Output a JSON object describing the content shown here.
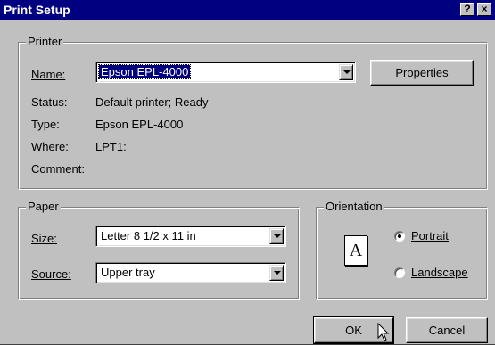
{
  "window": {
    "title": "Print Setup",
    "help_button": "?",
    "close_button": "×"
  },
  "printer_group": {
    "label": "Printer",
    "name_label": "Name:",
    "name_value": "Epson EPL-4000",
    "properties_button": "Properties",
    "status_label": "Status:",
    "status_value": "Default printer; Ready",
    "type_label": "Type:",
    "type_value": "Epson EPL-4000",
    "where_label": "Where:",
    "where_value": "LPT1:",
    "comment_label": "Comment:",
    "comment_value": ""
  },
  "paper_group": {
    "label": "Paper",
    "size_label": "Size:",
    "size_value": "Letter 8 1/2 x 11 in",
    "source_label": "Source:",
    "source_value": "Upper tray"
  },
  "orientation_group": {
    "label": "Orientation",
    "icon_letter": "A",
    "portrait_label": "Portrait",
    "landscape_label": "Landscape",
    "selected": "Portrait"
  },
  "buttons": {
    "ok": "OK",
    "cancel": "Cancel"
  },
  "colors": {
    "title_bar": "#000080",
    "dialog_face": "#c0c0c0",
    "selection": "#000080"
  },
  "icons": [
    "help-icon",
    "close-icon",
    "chevron-down-icon",
    "portrait-page-icon",
    "mouse-pointer-icon"
  ]
}
